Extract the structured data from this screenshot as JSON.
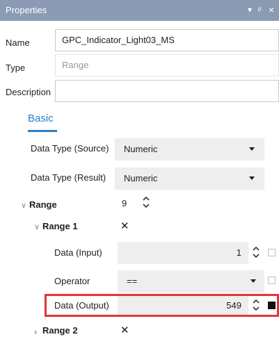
{
  "panel": {
    "title": "Properties",
    "controls": {
      "menu": "▾",
      "pin": "ᵖ",
      "close": "×"
    }
  },
  "fields": {
    "name": {
      "label": "Name",
      "value": "GPC_Indicator_Light03_MS"
    },
    "type": {
      "label": "Type",
      "value": "Range"
    },
    "description": {
      "label": "Description",
      "value": ""
    }
  },
  "tabs": {
    "basic": "Basic"
  },
  "basic": {
    "data_type_source": {
      "label": "Data Type (Source)",
      "value": "Numeric"
    },
    "data_type_result": {
      "label": "Data Type (Result)",
      "value": "Numeric"
    },
    "range": {
      "label": "Range",
      "count": "9"
    },
    "range1": {
      "label": "Range 1",
      "remove": "✕",
      "data_input": {
        "label": "Data (Input)",
        "value": "1",
        "checked": false
      },
      "operator": {
        "label": "Operator",
        "value": "==",
        "checked": false
      },
      "data_output": {
        "label": "Data (Output)",
        "value": "549",
        "checked": true
      }
    },
    "range2": {
      "label": "Range 2",
      "remove": "✕"
    }
  },
  "icons": {
    "expanded": "∨",
    "collapsed": "›"
  },
  "colors": {
    "titlebar": "#8b9bb4",
    "accent": "#2b7fc8",
    "highlight": "#e8323a"
  }
}
